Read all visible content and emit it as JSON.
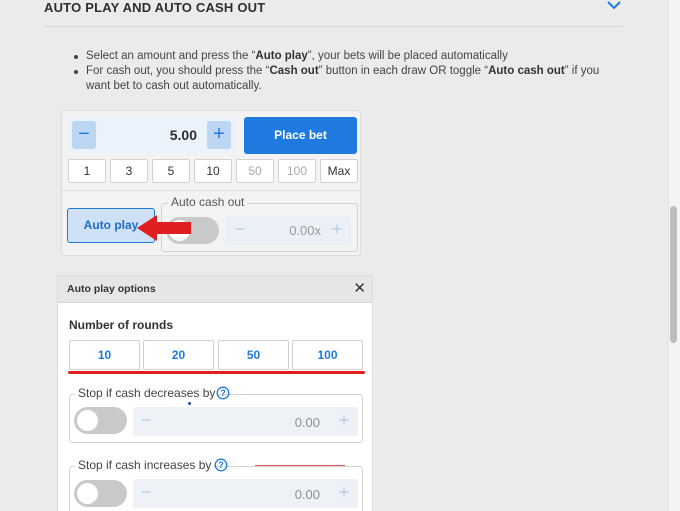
{
  "section": {
    "title": "AUTO PLAY AND AUTO CASH OUT",
    "toggle_icon": "chevron-down-icon",
    "accent_color": "#1f7ae0"
  },
  "instructions": {
    "item1": {
      "before": "Select an amount and press the “",
      "bold": "Auto play",
      "after": "”, your bets will be placed automatically"
    },
    "item2": {
      "before": "For cash out, you should press the “",
      "bold1": "Cash out",
      "middle": "” button in each draw OR toggle “",
      "bold2": "Auto cash out",
      "after": "” if you want bet to cash out automatically."
    }
  },
  "bet_panel": {
    "minus": "−",
    "plus": "+",
    "amount": "5.00",
    "place_bet": "Place bet",
    "quick_amounts": [
      "1",
      "3",
      "5",
      "10",
      "50",
      "100",
      "Max"
    ],
    "auto_play": "Auto play",
    "auto_cash_out_label": "Auto cash out",
    "multiplier": "0.00x",
    "auto_cash_out_enabled": false
  },
  "auto_play_options": {
    "title": "Auto play options",
    "close": "✕",
    "rounds_label": "Number of rounds",
    "rounds": [
      "10",
      "20",
      "50",
      "100"
    ],
    "stop_decrease": {
      "label": "Stop if cash decreases by",
      "value": "0.00",
      "minus": "−",
      "plus": "+",
      "enabled": false
    },
    "stop_increase": {
      "label": "Stop if cash increases by",
      "value": "0.00",
      "minus": "−",
      "plus": "+",
      "enabled": false
    }
  },
  "annotations": {
    "arrow_color": "#e02020",
    "underline_color": "#e02020"
  }
}
